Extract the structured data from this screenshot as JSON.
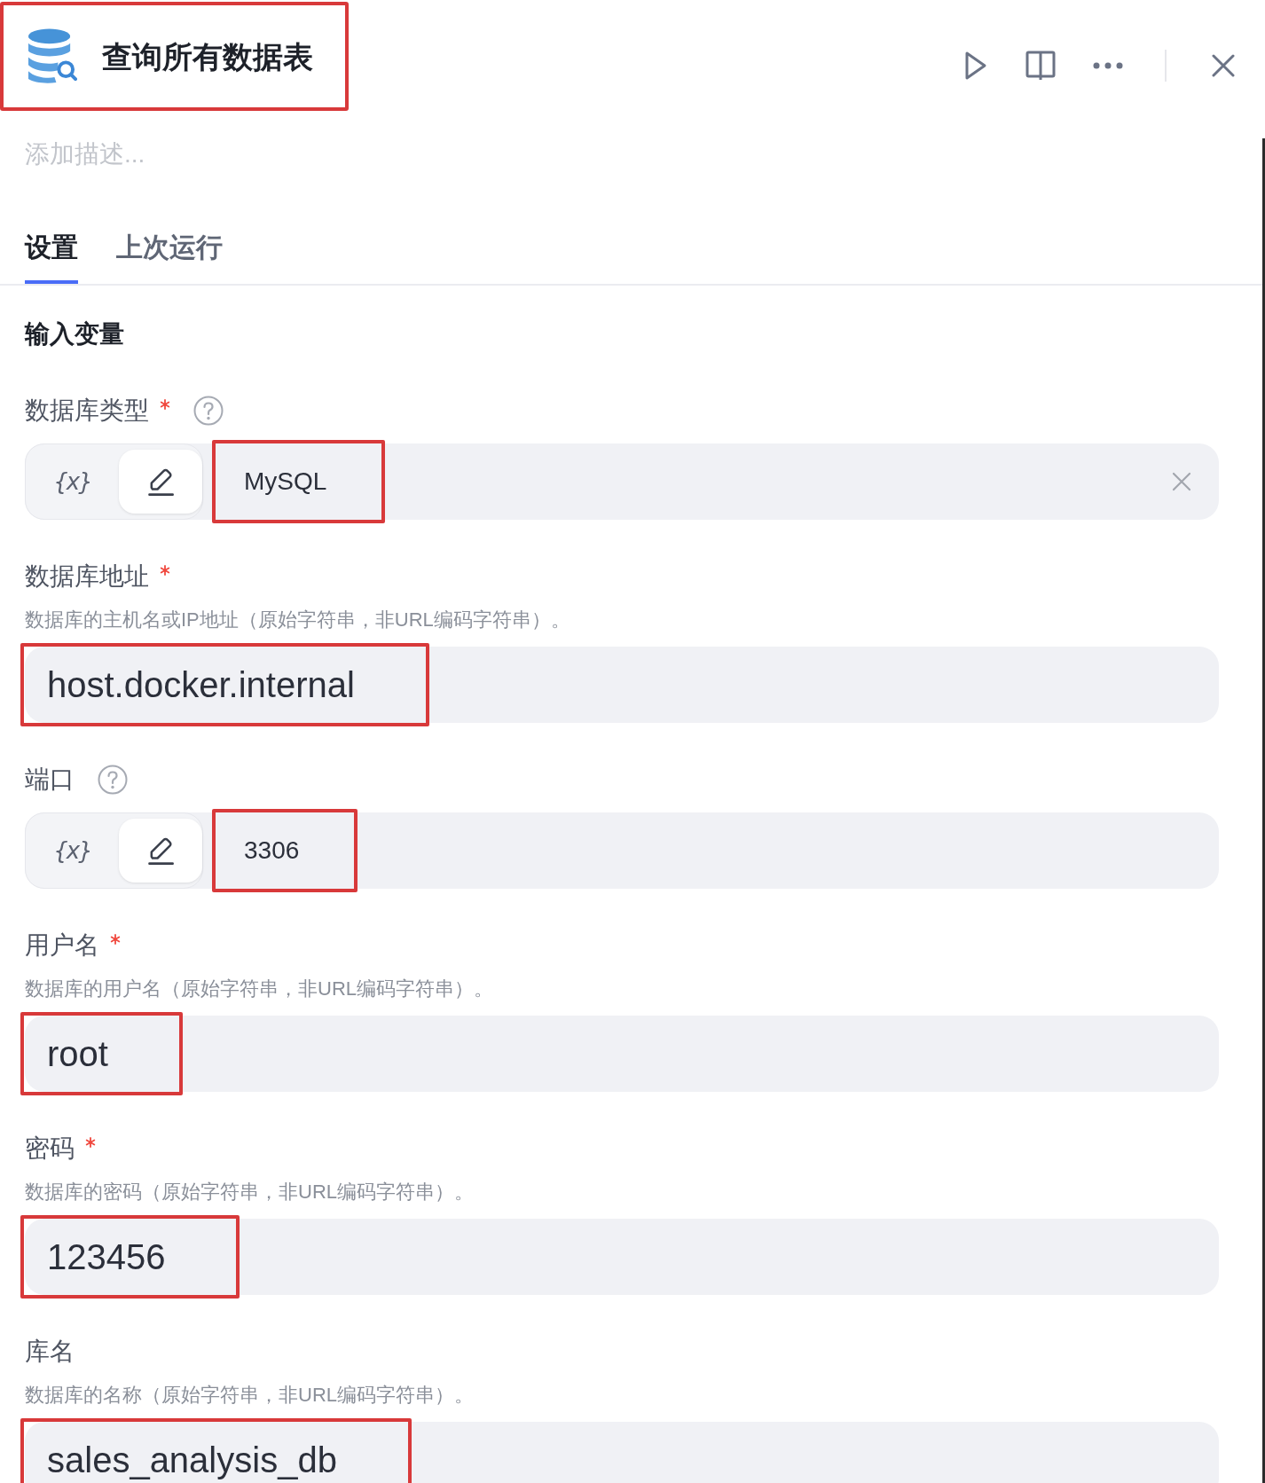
{
  "header": {
    "title": "查询所有数据表",
    "highlighted": true
  },
  "description": {
    "placeholder": "添加描述..."
  },
  "tabs": [
    {
      "label": "设置",
      "selected": true
    },
    {
      "label": "上次运行",
      "selected": false
    }
  ],
  "section": {
    "title": "输入变量"
  },
  "fields": [
    {
      "kind": "toggle",
      "label": "数据库类型",
      "required": true,
      "help": true,
      "mode_toggle": [
        {
          "kind": "variable",
          "label": "{x}",
          "selected": false
        },
        {
          "kind": "constant",
          "selected": true
        }
      ],
      "value": "MySQL",
      "clearable": true,
      "highlighted": true
    },
    {
      "kind": "text",
      "label": "数据库地址",
      "required": true,
      "help": false,
      "description": "数据库的主机名或IP地址（原始字符串，非URL编码字符串）。",
      "value": "host.docker.internal",
      "clearable": false,
      "highlighted": true
    },
    {
      "kind": "toggle",
      "label": "端口",
      "required": false,
      "help": true,
      "mode_toggle": [
        {
          "kind": "variable",
          "label": "{x}",
          "selected": false
        },
        {
          "kind": "constant",
          "selected": true
        }
      ],
      "value": "3306",
      "clearable": false,
      "highlighted": true
    },
    {
      "kind": "text",
      "label": "用户名",
      "required": true,
      "help": false,
      "description": "数据库的用户名（原始字符串，非URL编码字符串）。",
      "value": "root",
      "clearable": false,
      "highlighted": true
    },
    {
      "kind": "text",
      "label": "密码",
      "required": true,
      "help": false,
      "description": "数据库的密码（原始字符串，非URL编码字符串）。",
      "value": "123456",
      "clearable": false,
      "highlighted": true
    },
    {
      "kind": "text",
      "label": "库名",
      "required": false,
      "help": false,
      "description": "数据库的名称（原始字符串，非URL编码字符串）。",
      "value": "sales_analysis_db",
      "clearable": false,
      "highlighted": true
    }
  ]
}
